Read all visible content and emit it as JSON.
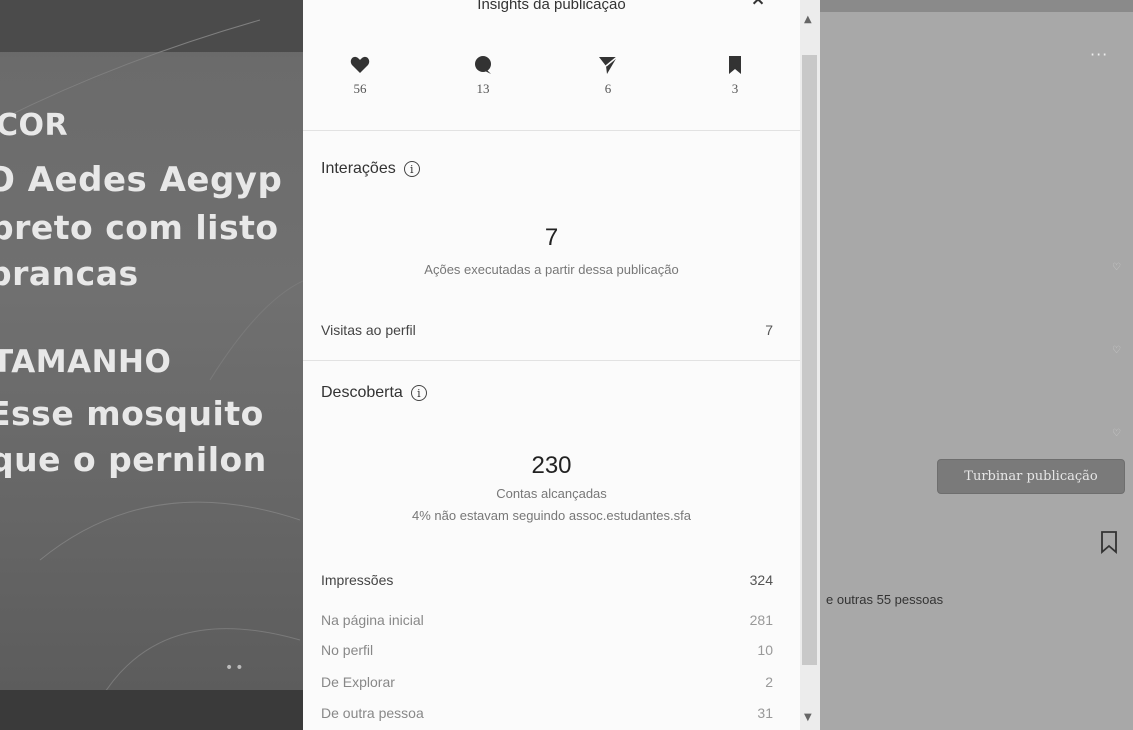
{
  "post": {
    "lines": [
      "COR",
      "O Aedes Aegyp",
      "preto com listo",
      "brancas",
      "TAMANHO",
      "Esse mosquito",
      "que o pernilon"
    ],
    "dots": "••"
  },
  "insights": {
    "title": "Insights da publicação",
    "close_icon": "chevron-up",
    "stats": [
      {
        "icon": "heart-icon",
        "value": "56"
      },
      {
        "icon": "comment-icon",
        "value": "13"
      },
      {
        "icon": "share-icon",
        "value": "6"
      },
      {
        "icon": "bookmark-icon",
        "value": "3"
      }
    ],
    "interactions": {
      "title": "Interações",
      "info": "i",
      "total": "7",
      "subtitle": "Ações executadas a partir dessa publicação",
      "profile_visits_label": "Visitas ao perfil",
      "profile_visits_value": "7"
    },
    "discovery": {
      "title": "Descoberta",
      "info": "i",
      "reach": "230",
      "reach_label": "Contas alcançadas",
      "not_following": "4% não estavam seguindo assoc.estudantes.sfa",
      "impressions_label": "Impressões",
      "impressions_value": "324",
      "breakdown": [
        {
          "label": "Na página inicial",
          "value": "281"
        },
        {
          "label": "No perfil",
          "value": "10"
        },
        {
          "label": "De Explorar",
          "value": "2"
        },
        {
          "label": "De outra pessoa",
          "value": "31"
        }
      ]
    }
  },
  "right_panel": {
    "more": "···",
    "boost_label": "Turbinar publicação",
    "likes_text": "e outras 55 pessoas"
  },
  "colors": {
    "modal_bg": "#fbfbfb",
    "background_dark": "#2b2b2b",
    "right_bg": "#a8a8a8"
  }
}
